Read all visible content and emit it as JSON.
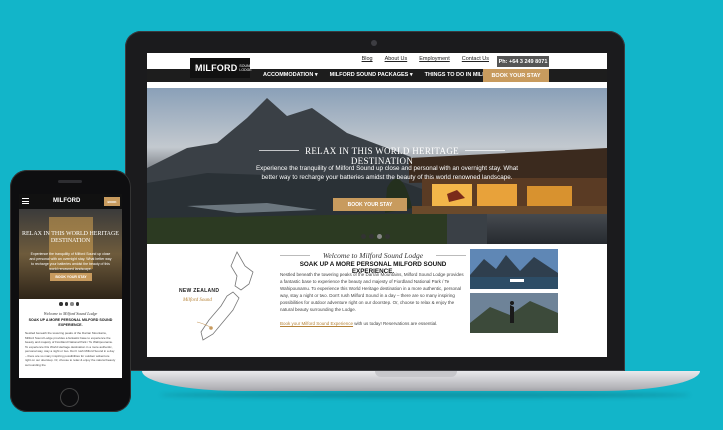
{
  "site": {
    "logo": {
      "word": "MILFORD",
      "sub_line1": "SOUND",
      "sub_line2": "LODGE"
    },
    "top_links": [
      "Blog",
      "About Us",
      "Employment",
      "Contact Us"
    ],
    "phone": "Ph: +64 3 249 8071",
    "nav": [
      "ACCOMMODATION ▾",
      "MILFORD SOUND PACKAGES ▾",
      "THINGS TO DO IN MILFORD SOUND ▾"
    ],
    "book_nav": "BOOK YOUR STAY",
    "hero": {
      "heading": "RELAX IN THIS WORLD HERITAGE DESTINATION",
      "text": "Experience the tranquility of Milford Sound up close and personal with an overnight stay. What better way to recharge your batteries amidst the beauty of this world renowned landscape.",
      "button": "BOOK YOUR STAY"
    },
    "map": {
      "label1": "NEW ZEALAND",
      "label2": "Milford Sound"
    },
    "welcome": "Welcome to Milford Sound Lodge",
    "subheading": "SOAK UP A MORE PERSONAL MILFORD SOUND EXPERIENCE.",
    "body": "Nestled beneath the towering peaks of the Darran Mountains, Milford Sound Lodge provides a fantastic base to experience the beauty and majesty of Fiordland National Park / Te Wahipounamu. To experience this World Heritage destination in a more authentic, personal way, stay a night or two. Don't rush Milford Sound in a day – there are so many inspiring possibilities for outdoor adventure right on our doorstep. Or, choose to relax & enjoy the natural beauty surrounding the Lodge.",
    "link_gold": "Book your Milford Sound Experience",
    "link_rest": " with us today! Reservations are essential."
  },
  "mobile": {
    "logo": "MILFORD",
    "book": "BOOK",
    "hero_title": "RELAX IN THIS WORLD HERITAGE DESTINATION",
    "hero_text": "Experience the tranquility of Milford Sound up close and personal with an overnight stay. What better way to recharge your batteries amidst the beauty of this world renowned landscape.",
    "hero_button": "BOOK YOUR STAY",
    "welcome": "Welcome to Milford Sound Lodge",
    "subheading": "SOAK UP A MORE PERSONAL MILFORD SOUND EXPERIENCE.",
    "body": "Nestled beneath the towering peaks of the Darran Mountains, Milford Sound Lodge provides a fantastic base to experience the beauty and majesty of Fiordland National Park / Te Wahipounamu. To experience this World Heritage destination in a more authentic, personal way, stay a night or two. Don't rush Milford Sound in a day – there are so many inspiring possibilities for outdoor adventure right on our doorstep. Or, choose to relax & enjoy the natural beauty surrounding the"
  },
  "colors": {
    "background": "#12b5c9",
    "accent": "#c89b5e",
    "nav": "#1d1d1d"
  }
}
